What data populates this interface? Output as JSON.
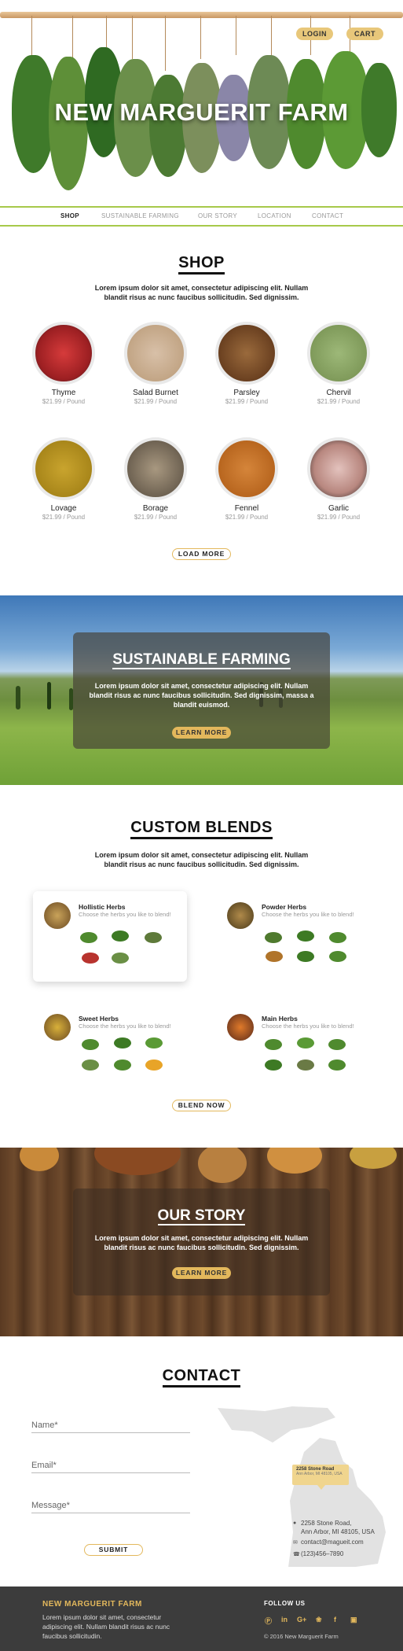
{
  "hero": {
    "title": "NEW MARGUERIT FARM",
    "login_label": "LOGIN",
    "cart_label": "CART"
  },
  "nav": {
    "items": [
      {
        "label": "SHOP",
        "active": true
      },
      {
        "label": "SUSTAINABLE FARMING",
        "active": false
      },
      {
        "label": "OUR STORY",
        "active": false
      },
      {
        "label": "LOCATION",
        "active": false
      },
      {
        "label": "CONTACT",
        "active": false
      }
    ]
  },
  "shop": {
    "title": "SHOP",
    "description": "Lorem ipsum dolor sit amet, consectetur adipiscing elit. Nullam blandit risus ac nunc faucibus sollicitudin. Sed dignissim.",
    "products": [
      {
        "name": "Thyme",
        "price": "$21.99 / Pound",
        "color": "#b4262a"
      },
      {
        "name": "Salad Burnet",
        "price": "$21.99 / Pound",
        "color": "#c8ad93"
      },
      {
        "name": "Parsley",
        "price": "$21.99 / Pound",
        "color": "#7a5230"
      },
      {
        "name": "Chervil",
        "price": "$21.99 / Pound",
        "color": "#8ea666"
      },
      {
        "name": "Lovage",
        "price": "$21.99 / Pound",
        "color": "#b5931e"
      },
      {
        "name": "Borage",
        "price": "$21.99 / Pound",
        "color": "#8a7c68"
      },
      {
        "name": "Fennel",
        "price": "$21.99 / Pound",
        "color": "#c9762a"
      },
      {
        "name": "Garlic",
        "price": "$21.99 / Pound",
        "color": "#caa29b"
      }
    ],
    "load_more_label": "LOAD MORE"
  },
  "farming": {
    "title": "SUSTAINABLE FARMING",
    "description": "Lorem ipsum dolor sit amet, consectetur adipiscing elit. Nullam blandit risus ac nunc faucibus sollicitudin. Sed dignissim, massa a blandit euismod.",
    "button_label": "LEARN MORE"
  },
  "blends": {
    "title": "CUSTOM BLENDS",
    "description": "Lorem ipsum dolor sit amet, consectetur adipiscing elit. Nullam blandit risus ac nunc faucibus sollicitudin. Sed dignissim.",
    "items": [
      {
        "name": "Hollistic Herbs",
        "subtitle": "Choose the herbs you like to blend!",
        "color": "#9a7a4a",
        "highlighted": true
      },
      {
        "name": "Powder Herbs",
        "subtitle": "Choose the herbs you like to blend!",
        "color": "#7a6a3a",
        "highlighted": false
      },
      {
        "name": "Sweet Herbs",
        "subtitle": "Choose the herbs you like to blend!",
        "color": "#a88a2a",
        "highlighted": false
      },
      {
        "name": "Main Herbs",
        "subtitle": "Choose the herbs you like to blend!",
        "color": "#c0502a",
        "highlighted": false
      }
    ],
    "button_label": "BLEND NOW"
  },
  "story": {
    "title": "OUR STORY",
    "description": "Lorem ipsum dolor sit amet, consectetur adipiscing elit. Nullam blandit risus ac nunc faucibus sollicitudin. Sed dignissim.",
    "button_label": "LEARN MORE"
  },
  "contact": {
    "title": "CONTACT",
    "name_placeholder": "Name*",
    "email_placeholder": "Email*",
    "message_placeholder": "Message*",
    "submit_label": "SUBMIT",
    "map_tooltip_title": "2258 Stone Road",
    "map_tooltip_sub": "Ann Arbor, MI 48105, USA",
    "address_line1": "2258 Stone Road,",
    "address_line2": "Ann Arbor, MI 48105, USA",
    "email": "contact@magueit.com",
    "phone": "(123)456–7890"
  },
  "footer": {
    "brand": "NEW MARGUERIT FARM",
    "text": "Lorem ipsum dolor sit amet, consectetur adipiscing elit. Nullam blandit risus ac nunc faucibus sollicitudin.",
    "follow_label": "FOLLOW US",
    "copyright": "© 2016 New Marguerit Farm",
    "social_icons": [
      "pinterest-icon",
      "linkedin-icon",
      "google-plus-icon",
      "twitter-icon",
      "facebook-icon",
      "instagram-icon"
    ]
  },
  "colors": {
    "accent_gold": "#e3b85c",
    "nav_green": "#a7c94a",
    "footer_bg": "#3c3c3c"
  }
}
